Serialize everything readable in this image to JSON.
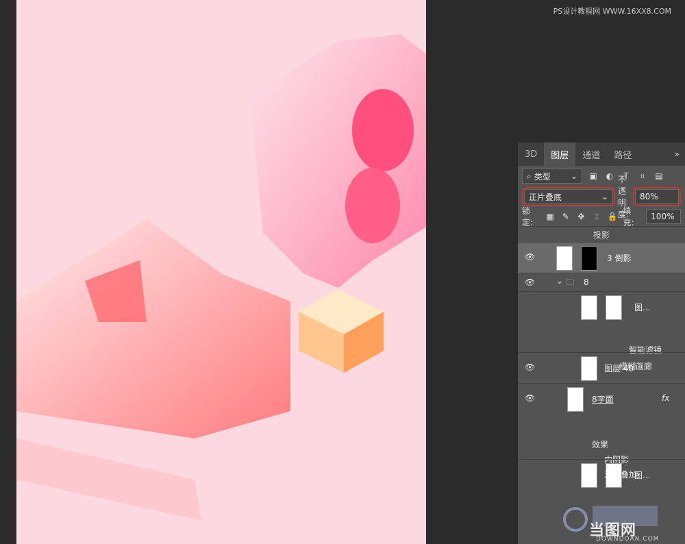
{
  "watermark_top": "PS设计教程网 WWW.16XX8.COM",
  "watermark_bottom": {
    "main": "当图网",
    "sub": "DOWNDOAN.COM"
  },
  "canvas": {
    "background": "#fbd9de"
  },
  "panel": {
    "tabs": [
      {
        "label": "3D",
        "active": false
      },
      {
        "label": "图层",
        "active": true
      },
      {
        "label": "通道",
        "active": false
      },
      {
        "label": "路径",
        "active": false
      }
    ],
    "tab_menu": "»",
    "filter": {
      "label": "类型"
    },
    "blend_mode": "正片叠底",
    "opacity_label": "不透明度:",
    "opacity_value": "80%",
    "lock_label": "锁定:",
    "fill_label": "填充:",
    "fill_value": "100%",
    "section_label": "投影",
    "layers": [
      {
        "name": "3 倒影"
      },
      {
        "name": "8"
      },
      {
        "name": "图..."
      },
      {
        "name": "智能滤镜"
      },
      {
        "name": "模糊画廊"
      },
      {
        "name": "图层 40"
      },
      {
        "name": "8字面"
      },
      {
        "name": "效果"
      },
      {
        "name": "内阴影"
      },
      {
        "name": "渐变叠加"
      },
      {
        "name": "图..."
      }
    ],
    "fx_label": "fx"
  }
}
